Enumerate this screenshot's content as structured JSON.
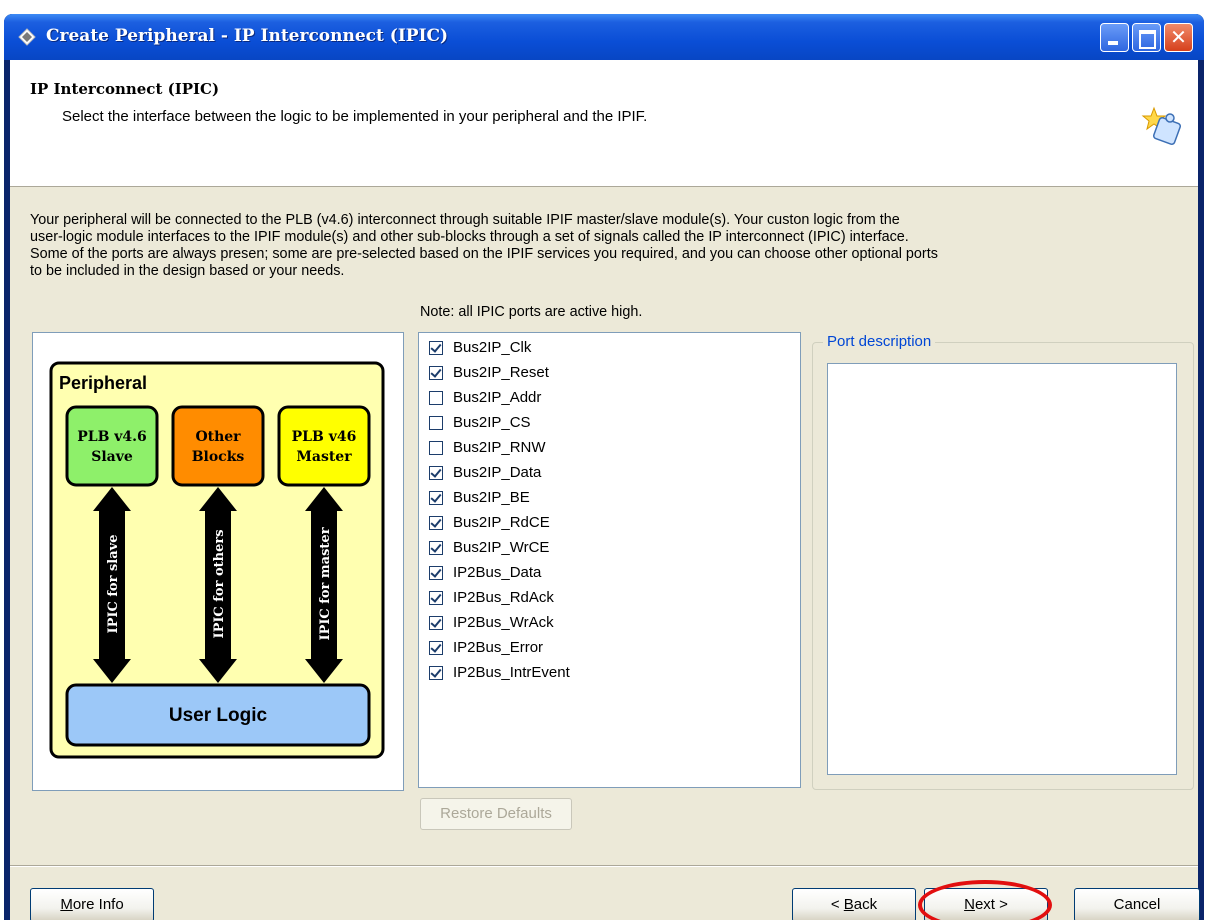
{
  "window": {
    "title": "Create Peripheral - IP Interconnect (IPIC)"
  },
  "header": {
    "title": "IP Interconnect (IPIC)",
    "subtitle": "Select the interface between the logic to be implemented in your peripheral and the IPIF."
  },
  "intro": {
    "line1": "Your peripheral will be connected to the PLB (v4.6) interconnect through suitable IPIF master/slave module(s). Your custon logic from the",
    "line2": "user-logic module interfaces to the IPIF module(s) and other sub-blocks through a set of signals called the IP interconnect (IPIC) interface.",
    "line3": "Some of the ports are always presen; some are pre-selected based on the IPIF services you required, and you can choose other optional ports",
    "line4": "to be included in the design based or your needs."
  },
  "note": "Note: all IPIC ports are active high.",
  "diagram": {
    "peripheral_label": "Peripheral",
    "slave_label_1": "PLB v4.6",
    "slave_label_2": "Slave",
    "other_label_1": "Other",
    "other_label_2": "Blocks",
    "master_label_1": "PLB v46",
    "master_label_2": "Master",
    "ipic_slave": "IPIC for slave",
    "ipic_others": "IPIC for others",
    "ipic_master": "IPIC for master",
    "user_logic": "User Logic",
    "colors": {
      "slave": "#8ef06a",
      "other": "#ff8c00",
      "master": "#ffff00",
      "user_logic": "#9cc8f8",
      "peripheral_bg": "#ffffb0"
    }
  },
  "ports": [
    {
      "name": "Bus2IP_Clk",
      "checked": true
    },
    {
      "name": "Bus2IP_Reset",
      "checked": true
    },
    {
      "name": "Bus2IP_Addr",
      "checked": false
    },
    {
      "name": "Bus2IP_CS",
      "checked": false
    },
    {
      "name": "Bus2IP_RNW",
      "checked": false
    },
    {
      "name": "Bus2IP_Data",
      "checked": true
    },
    {
      "name": "Bus2IP_BE",
      "checked": true
    },
    {
      "name": "Bus2IP_RdCE",
      "checked": true
    },
    {
      "name": "Bus2IP_WrCE",
      "checked": true
    },
    {
      "name": "IP2Bus_Data",
      "checked": true
    },
    {
      "name": "IP2Bus_RdAck",
      "checked": true
    },
    {
      "name": "IP2Bus_WrAck",
      "checked": true
    },
    {
      "name": "IP2Bus_Error",
      "checked": true
    },
    {
      "name": "IP2Bus_IntrEvent",
      "checked": true
    }
  ],
  "port_description": {
    "legend": "Port description",
    "text": ""
  },
  "buttons": {
    "restore_defaults": "Restore Defaults",
    "more_info_mnemonic": "M",
    "more_info_rest": "ore Info",
    "back_prefix": "< ",
    "back_mnemonic": "B",
    "back_rest": "ack",
    "next_mnemonic": "N",
    "next_rest": "ext >",
    "cancel": "Cancel"
  }
}
